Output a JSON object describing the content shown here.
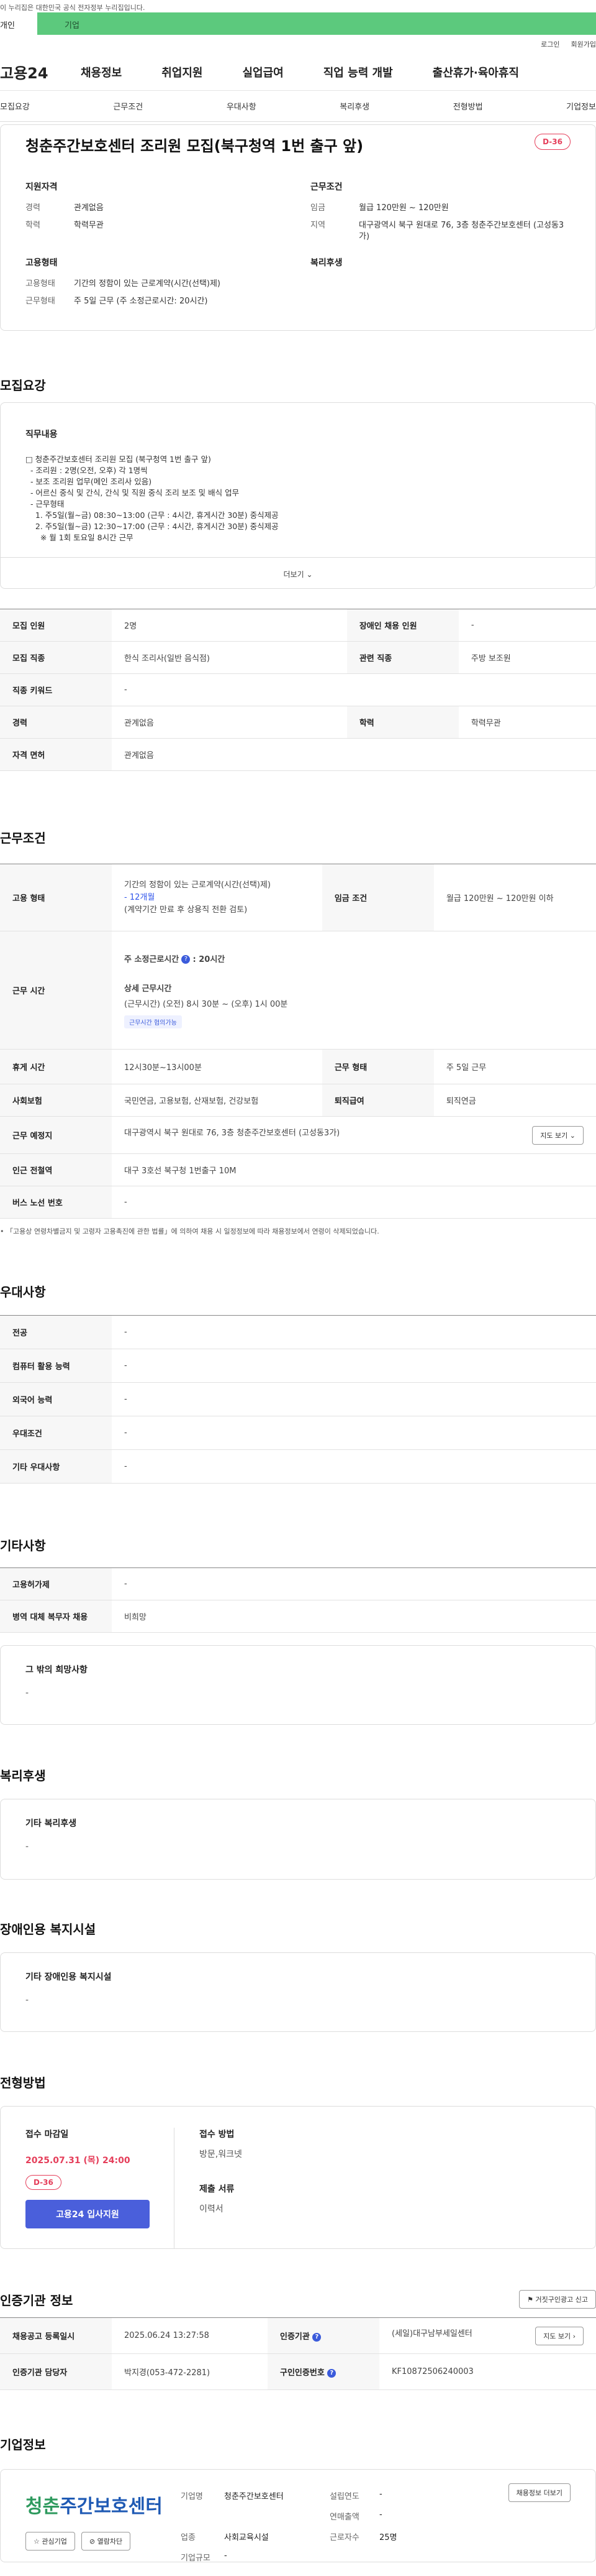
{
  "banner": {
    "text": "이 누리집은 대한민국 공식 전자정부 누리집입니다."
  },
  "tabs": {
    "person": "개인",
    "company": "기업"
  },
  "util": {
    "login": "로그인",
    "signup": "회원가입"
  },
  "gnb": {
    "logo": "고용24",
    "items": [
      "채용정보",
      "취업지원",
      "실업급여",
      "직업 능력 개발",
      "출산휴가·육아휴직"
    ]
  },
  "lnb": {
    "items": [
      "모집요강",
      "근무조건",
      "우대사항",
      "복리후생",
      "전형방법",
      "기업정보"
    ]
  },
  "job": {
    "title": "청춘주간보호센터 조리원 모집(북구청역 1번 출구 앞)",
    "dday": "D-36",
    "qual_head": "지원자격",
    "qual": [
      {
        "k": "경력",
        "v": "관계없음"
      },
      {
        "k": "학력",
        "v": "학력무관"
      }
    ],
    "cond_head": "근무조건",
    "cond": [
      {
        "k": "임금",
        "v": "월급 120만원 ~ 120만원"
      },
      {
        "k": "지역",
        "v": "대구광역시 북구 원대로 76, 3층 청춘주간보호센터 (고성동3가)"
      }
    ],
    "emp_head": "고용형태",
    "emp": [
      {
        "k": "고용형태",
        "v": "기간의 정함이 있는 근로계약(시간(선택)제)"
      },
      {
        "k": "근무형태",
        "v": "주 5일 근무 (주 소정근로시간: 20시간)"
      }
    ],
    "welfare_head": "복리후생"
  },
  "recruit": {
    "title": "모집요강",
    "duty_label": "직무내용",
    "duty_text": "□ 청춘주간보호센터 조리원 모집 (북구청역 1번 출구 앞)\n  - 조리원 : 2명(오전, 오후) 각 1명씩\n  - 보조 조리원 업무(메인 조리사 있음)\n  - 어르신 중식 및 간식, 간식 및 직원 중식 조리 보조 및 배식 업무\n  - 근무형태\n    1. 주5일(월~금) 08:30~13:00 (근무 : 4시간, 휴게시간 30분) 중식제공\n    2. 주5일(월~금) 12:30~17:00 (근무 : 4시간, 휴게시간 30분) 중식제공\n      ※ 월 1회 토요일 8시간 근무",
    "more": "더보기",
    "rows": [
      {
        "k1": "모집 인원",
        "v1": "2명",
        "k2": "장애인 채용 인원",
        "v2": "-"
      },
      {
        "k1": "모집 직종",
        "v1": "한식 조리사(일반 음식점)",
        "k2": "관련 직종",
        "v2": "주방 보조원"
      },
      {
        "k1": "직종 키워드",
        "v1": "-"
      },
      {
        "k1": "경력",
        "v1": "관계없음",
        "k2": "학력",
        "v2": "학력무관"
      },
      {
        "k1": "자격 면허",
        "v1": "관계없음"
      }
    ]
  },
  "work": {
    "title": "근무조건",
    "emp_k": "고용 형태",
    "emp_v": "기간의 정함이 있는 근로계약(시간(선택)제)",
    "emp_months": "- 12개월",
    "emp_note": "(계약기간 만료 후 상용직 전환 검토)",
    "wage_k": "임금 조건",
    "wage_v": "월급 120만원 ~ 120만원 이하",
    "time_k": "근무 시간",
    "weekly": "주 소정근로시간",
    "weekly_v": ": 20시간",
    "detail_label": "상세 근무시간",
    "detail_v": "(근무시간) (오전) 8시 30분 ~ (오후) 1시 00분",
    "chip": "근무시간 협의가능",
    "rest_k": "휴게 시간",
    "rest_v": "12시30분~13시00분",
    "form_k": "근무 형태",
    "form_v": "주 5일 근무",
    "ins_k": "사회보험",
    "ins_v": "국민연금, 고용보험, 산재보험, 건강보험",
    "ret_k": "퇴직급여",
    "ret_v": "퇴직연금",
    "place_k": "근무 예정지",
    "place_v": "대구광역시 북구 원대로 76, 3층 청춘주간보호센터 (고성동3가)",
    "map_btn": "지도 보기",
    "sub_k": "인근 전철역",
    "sub_v": "대구 3호선 북구청 1번출구 10M",
    "bus_k": "버스 노선 번호",
    "bus_v": "-",
    "note": "「고용상 연령차별금지 및 고령자 고용촉진에 관한 법률」에 의하여 채용 시 일정정보에 따라 채용정보에서 연령이 삭제되었습니다."
  },
  "pref": {
    "title": "우대사항",
    "rows": [
      {
        "k": "전공",
        "v": "-"
      },
      {
        "k": "컴퓨터 활용 능력",
        "v": "-"
      },
      {
        "k": "외국어 능력",
        "v": "-"
      },
      {
        "k": "우대조건",
        "v": "-"
      },
      {
        "k": "기타 우대사항",
        "v": "-"
      }
    ]
  },
  "etc": {
    "title": "기타사항",
    "rows": [
      {
        "k": "고용허가제",
        "v": "-"
      },
      {
        "k": "병역 대체 복무자 채용",
        "v": "비희망"
      }
    ],
    "other_label": "그 밖의 희망사항",
    "other_v": "-"
  },
  "welfare": {
    "title": "복리후생",
    "label": "기타 복리후생",
    "v": "-"
  },
  "facility": {
    "title": "장애인용 복지시설",
    "label": "기타 장애인용 복지시설",
    "v": "-"
  },
  "apply": {
    "title": "전형방법",
    "deadline_label": "접수 마감일",
    "deadline": "2025.07.31 (목) 24:00",
    "dday": "D-36",
    "btn": "고용24 입사지원",
    "method_label": "접수 방법",
    "method_v": "방문,워크넷",
    "docs_label": "제출 서류",
    "docs_v": "이력서"
  },
  "cert": {
    "title": "인증기관 정보",
    "report_btn": "거짓구인광고 신고",
    "reg_k": "채용공고 등록일시",
    "reg_v": "2025.06.24 13:27:58",
    "org_k": "인증기관",
    "org_v": "(세일)대구남부세일센터",
    "map_btn": "지도 보기",
    "mgr_k": "인증기관 담당자",
    "mgr_v": "박지경(053-472-2281)",
    "no_k": "구인인증번호",
    "no_v": "KF10872506240003"
  },
  "corp": {
    "title": "기업정보",
    "logo_green": "청춘",
    "logo_blue": "주간보호센터",
    "fav_btn": "관심기업",
    "block_btn": "열람차단",
    "view_btn": "채용정보 더보기",
    "name_k": "기업명",
    "name_v": "청춘주간보호센터",
    "year_k": "설립연도",
    "year_v": "-",
    "sales_k": "연매출액",
    "sales_v": "-",
    "ind_k": "업종",
    "ind_v": "사회교육시설",
    "emp_k": "근로자수",
    "emp_v": "25명",
    "size_k": "기업규모",
    "size_v": "-"
  }
}
